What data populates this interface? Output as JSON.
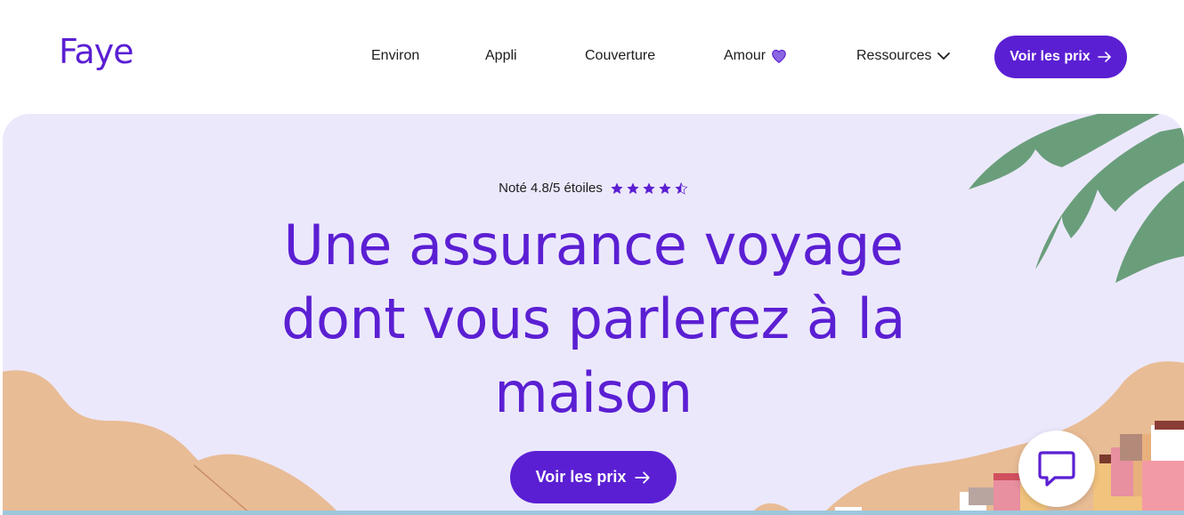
{
  "header": {
    "logo": "Faye",
    "nav": [
      {
        "label": "Environ"
      },
      {
        "label": "Appli"
      },
      {
        "label": "Couverture"
      },
      {
        "label": "Amour"
      },
      {
        "label": "Ressources"
      }
    ],
    "cta_label": "Voir les prix"
  },
  "hero": {
    "rating_text": "Noté 4.8/5 étoiles",
    "rating_value": 4.8,
    "rating_max": 5,
    "headline_lines": [
      "Une assurance voyage",
      "dont vous parlerez à la",
      "maison"
    ],
    "cta_label": "Voir les prix"
  },
  "colors": {
    "brand": "#5b1fd3",
    "hero_bg": "#ece8fc",
    "sand": "#e8bc95",
    "leaf": "#6a9e7b",
    "heart": "#8a66e0"
  },
  "icons": {
    "heart": "heart-icon",
    "chevron": "chevron-down-icon",
    "arrow": "arrow-right-icon",
    "chat": "chat-bubble-icon",
    "star": "star-icon"
  }
}
